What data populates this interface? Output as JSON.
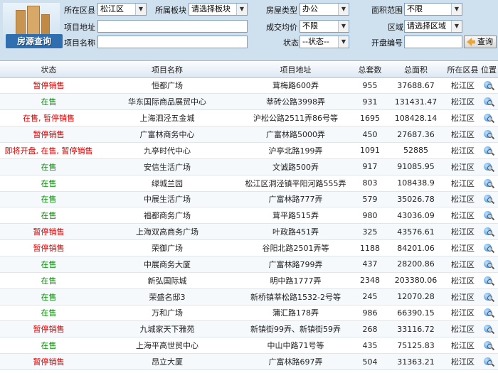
{
  "search": {
    "district_label": "所在区县",
    "district_value": "松江区",
    "block_label": "所属板块",
    "block_value": "请选择板块",
    "type_label": "房屋类型",
    "type_value": "办公",
    "area_label": "面积范围",
    "area_value": "不限",
    "address_label": "项目地址",
    "price_label": "成交均价",
    "price_value": "不限",
    "region_label": "区域",
    "region_value": "请选择区域",
    "name_label": "项目名称",
    "status_label": "状态",
    "status_value": "--状态--",
    "permit_label": "开盘编号",
    "search_button": "查询",
    "logo_text": "房源查询"
  },
  "table": {
    "headers": [
      "状态",
      "项目名称",
      "项目地址",
      "总套数",
      "总面积",
      "所在区县",
      "位置"
    ],
    "rows": [
      {
        "status": "暂停销售",
        "name": "恒都广场",
        "address": "茸梅路600弄",
        "units": "955",
        "area": "37688.67",
        "district": "松江区",
        "tone": "red"
      },
      {
        "status": "在售",
        "name": "华东国际商品展贸中心",
        "address": "莘砖公路3998弄",
        "units": "931",
        "area": "131431.47",
        "district": "松江区",
        "tone": "green"
      },
      {
        "status": "在售, 暂停销售",
        "name": "上海泗泾五金城",
        "address": "沪松公路2511弄86号等",
        "units": "1695",
        "area": "108428.14",
        "district": "松江区",
        "tone": "red"
      },
      {
        "status": "暂停销售",
        "name": "广富林商务中心",
        "address": "广富林路5000弄",
        "units": "450",
        "area": "27687.36",
        "district": "松江区",
        "tone": "red"
      },
      {
        "status": "即将开盘, 在售, 暂停销售",
        "name": "九亭时代中心",
        "address": "沪亭北路199弄",
        "units": "1091",
        "area": "52885",
        "district": "松江区",
        "tone": "red"
      },
      {
        "status": "在售",
        "name": "安信生活广场",
        "address": "文诚路500弄",
        "units": "917",
        "area": "91085.95",
        "district": "松江区",
        "tone": "green"
      },
      {
        "status": "在售",
        "name": "绿城兰园",
        "address": "松江区洞泾镇平阳河路555弄",
        "units": "803",
        "area": "108438.9",
        "district": "松江区",
        "tone": "green"
      },
      {
        "status": "在售",
        "name": "中展生活广场",
        "address": "广富林路777弄",
        "units": "579",
        "area": "35026.78",
        "district": "松江区",
        "tone": "green"
      },
      {
        "status": "在售",
        "name": "福都商务广场",
        "address": "茸平路515弄",
        "units": "980",
        "area": "43036.09",
        "district": "松江区",
        "tone": "green"
      },
      {
        "status": "暂停销售",
        "name": "上海双高商务广场",
        "address": "叶政路451弄",
        "units": "325",
        "area": "43576.61",
        "district": "松江区",
        "tone": "red"
      },
      {
        "status": "暂停销售",
        "name": "荣御广场",
        "address": "谷阳北路2501弄等",
        "units": "1188",
        "area": "84201.06",
        "district": "松江区",
        "tone": "red"
      },
      {
        "status": "在售",
        "name": "中展商务大厦",
        "address": "广富林路799弄",
        "units": "437",
        "area": "28200.86",
        "district": "松江区",
        "tone": "green"
      },
      {
        "status": "在售",
        "name": "新弘国际城",
        "address": "明中路1777弄",
        "units": "2348",
        "area": "203380.06",
        "district": "松江区",
        "tone": "green"
      },
      {
        "status": "在售",
        "name": "荣盛名邸3",
        "address": "新桥镇莘松路1532-2号等",
        "units": "245",
        "area": "12070.28",
        "district": "松江区",
        "tone": "green"
      },
      {
        "status": "在售",
        "name": "万和广场",
        "address": "蒲汇路178弄",
        "units": "986",
        "area": "66390.15",
        "district": "松江区",
        "tone": "green"
      },
      {
        "status": "暂停销售",
        "name": "九城家天下雅苑",
        "address": "新镇街99弄、新镇街59弄",
        "units": "268",
        "area": "33116.72",
        "district": "松江区",
        "tone": "red"
      },
      {
        "status": "在售",
        "name": "上海平高世贸中心",
        "address": "中山中路71号等",
        "units": "435",
        "area": "75125.83",
        "district": "松江区",
        "tone": "green"
      },
      {
        "status": "暂停销售",
        "name": "昂立大厦",
        "address": "广富林路697弄",
        "units": "504",
        "area": "31363.21",
        "district": "松江区",
        "tone": "red"
      }
    ]
  },
  "colors": {
    "status_red": "#d60000",
    "status_green": "#0c8a0c",
    "panel_bg": "#cfe0ee"
  },
  "icons": {
    "location": "map-search-icon",
    "search_button": "arrow-icon"
  }
}
